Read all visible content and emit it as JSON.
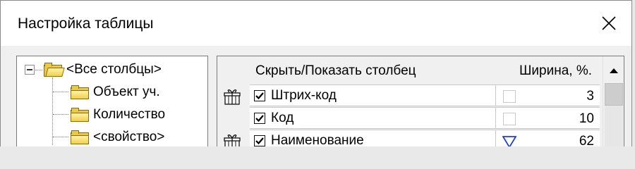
{
  "window": {
    "title": "Настройка таблицы",
    "close_icon": "close-icon"
  },
  "tree": {
    "root": {
      "label": "<Все столбцы>",
      "icon": "folder-open-icon",
      "expanded": true
    },
    "children": [
      {
        "label": "Объект уч.",
        "icon": "folder-icon"
      },
      {
        "label": "Количество",
        "icon": "folder-icon"
      },
      {
        "label": "<свойство>",
        "icon": "folder-icon"
      }
    ]
  },
  "grid": {
    "header": {
      "name_col": "Скрыть/Показать столбец",
      "width_col": "Ширина, %."
    },
    "rows": [
      {
        "icon": "gift-icon",
        "checked": true,
        "name": "Штрих-код",
        "width": "3",
        "width_marker": "empty-flag"
      },
      {
        "icon": "none",
        "checked": true,
        "name": "Код",
        "width": "10",
        "width_marker": "empty-flag"
      },
      {
        "icon": "gift-icon",
        "checked": true,
        "name": "Наименование",
        "width": "62",
        "width_marker": "sort-down-icon"
      }
    ],
    "scrollbar": {
      "up_icon": "scroll-up-arrow-icon"
    }
  },
  "colors": {
    "title_bg": "#ffffff",
    "dialog_bg": "#f0f0f0",
    "folder": "#e8c94a",
    "sort_icon": "#1f3fd6"
  }
}
